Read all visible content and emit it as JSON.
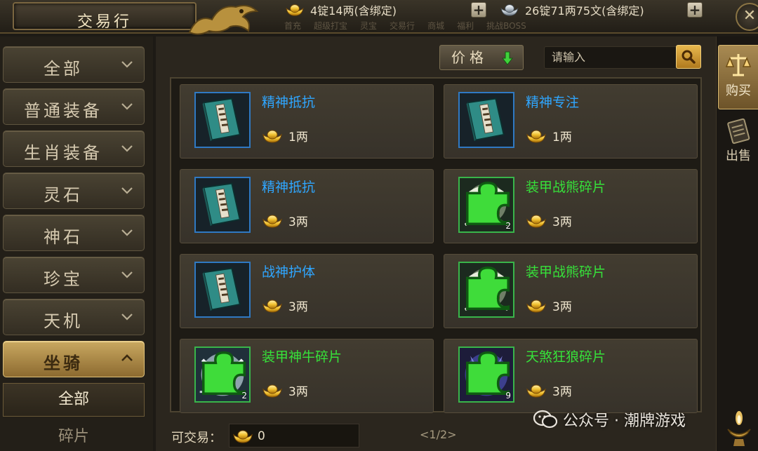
{
  "header": {
    "title": "交易行",
    "gold_label": "4锭14两(含绑定)",
    "silver_label": "26锭71两75文(含绑定)",
    "plus_symbol": "+",
    "close_symbol": "✕",
    "faded_nav": [
      "首充",
      "超级打宝",
      "灵宝",
      "交易行",
      "商城",
      "福利",
      "挑战BOSS"
    ]
  },
  "sidebar": {
    "categories": [
      {
        "label": "全部"
      },
      {
        "label": "普通装备"
      },
      {
        "label": "生肖装备"
      },
      {
        "label": "灵石"
      },
      {
        "label": "神石"
      },
      {
        "label": "珍宝"
      },
      {
        "label": "天机"
      },
      {
        "label": "坐骑"
      }
    ],
    "subcategories": [
      {
        "label": "全部"
      },
      {
        "label": "碎片"
      }
    ]
  },
  "toolbar": {
    "sort_label": "价格",
    "search_placeholder": "请输入"
  },
  "items": [
    {
      "name": "精神抵抗",
      "price": "1两",
      "name_color": "blue",
      "icon": "book-icon",
      "count": ""
    },
    {
      "name": "精神专注",
      "price": "1两",
      "name_color": "blue",
      "icon": "book-icon",
      "count": ""
    },
    {
      "name": "精神抵抗",
      "price": "3两",
      "name_color": "blue",
      "icon": "book-icon",
      "count": ""
    },
    {
      "name": "装甲战熊碎片",
      "price": "3两",
      "name_color": "green",
      "icon": "bear-fragment-icon",
      "count": "2"
    },
    {
      "name": "战神护体",
      "price": "3两",
      "name_color": "blue",
      "icon": "book-icon",
      "count": ""
    },
    {
      "name": "装甲战熊碎片",
      "price": "3两",
      "name_color": "green",
      "icon": "bear-fragment-icon",
      "count": ""
    },
    {
      "name": "装甲神牛碎片",
      "price": "3两",
      "name_color": "green",
      "icon": "bull-fragment-icon",
      "count": "2"
    },
    {
      "name": "天煞狂狼碎片",
      "price": "3两",
      "name_color": "green",
      "icon": "wolf-fragment-icon",
      "count": "9"
    }
  ],
  "footer": {
    "tradeable_label": "可交易：",
    "tradeable_value": "0",
    "page_indicator": "<1/2>"
  },
  "right_tabs": [
    {
      "label": "购买",
      "icon": "scales-icon"
    },
    {
      "label": "出售",
      "icon": "abacus-icon"
    }
  ],
  "watermark": "公众号 · 潮牌游戏",
  "colors": {
    "accent_gold": "#c9a860",
    "item_blue": "#2fa6ff",
    "item_green": "#36e23a",
    "panel_bg": "#2b261e"
  }
}
